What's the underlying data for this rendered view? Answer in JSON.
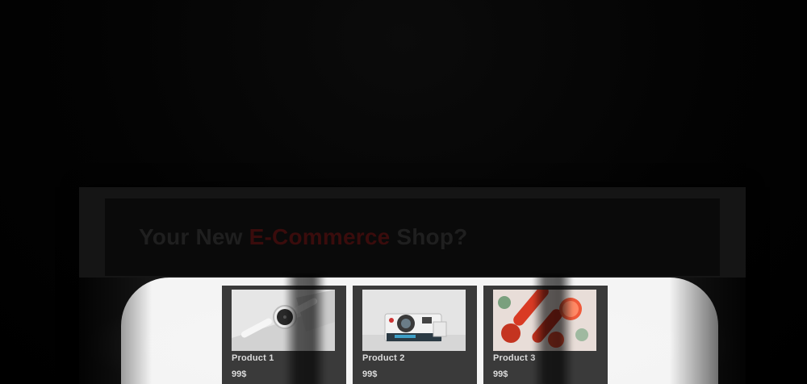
{
  "hero": {
    "title_start": "Your New ",
    "title_accent": "E-Commerce",
    "title_end": " Shop?"
  },
  "products": [
    {
      "name": "Product 1",
      "price": "99$",
      "image_icon": "smartwatch-image"
    },
    {
      "name": "Product 2",
      "price": "99$",
      "image_icon": "instant-camera-image"
    },
    {
      "name": "Product 3",
      "price": "99$",
      "image_icon": "grapefruit-image"
    }
  ],
  "colors": {
    "accent": "#3a0c0c",
    "card": "#3a3a3a",
    "shop_background": "#f4f4f4"
  }
}
